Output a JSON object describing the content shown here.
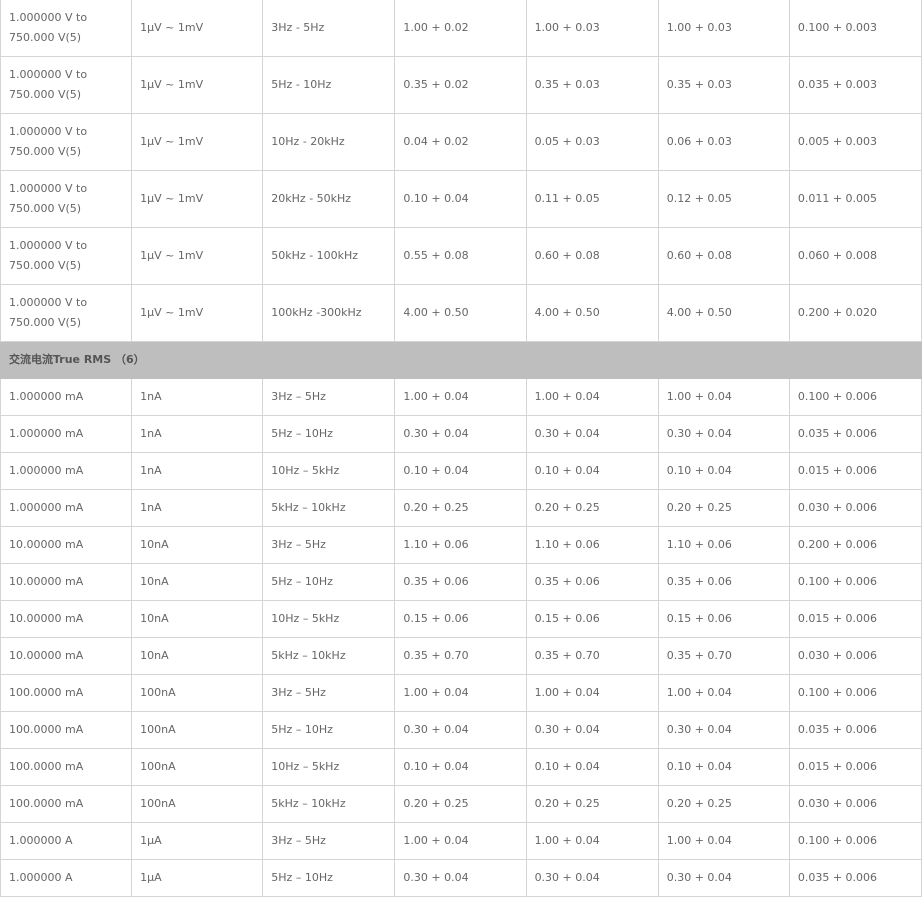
{
  "vac_rows": [
    [
      "1.000000 V to 750.000 V(5)",
      "1μV ~ 1mV",
      "3Hz - 5Hz",
      "1.00 + 0.02",
      "1.00 + 0.03",
      "1.00 + 0.03",
      "0.100 + 0.003"
    ],
    [
      "1.000000 V to 750.000 V(5)",
      "1μV ~ 1mV",
      "5Hz - 10Hz",
      "0.35 + 0.02",
      "0.35 + 0.03",
      "0.35 + 0.03",
      "0.035 + 0.003"
    ],
    [
      "1.000000 V to 750.000 V(5)",
      "1μV ~ 1mV",
      "10Hz - 20kHz",
      "0.04 + 0.02",
      "0.05 + 0.03",
      "0.06 + 0.03",
      "0.005 + 0.003"
    ],
    [
      "1.000000 V to 750.000 V(5)",
      "1μV ~ 1mV",
      "20kHz - 50kHz",
      "0.10 + 0.04",
      "0.11 + 0.05",
      "0.12 + 0.05",
      "0.011 + 0.005"
    ],
    [
      "1.000000 V to 750.000 V(5)",
      "1μV ~ 1mV",
      "50kHz - 100kHz",
      "0.55 + 0.08",
      "0.60 + 0.08",
      "0.60 + 0.08",
      "0.060 + 0.008"
    ],
    [
      "1.000000 V to 750.000 V(5)",
      "1μV ~ 1mV",
      "100kHz -300kHz",
      "4.00 + 0.50",
      "4.00 + 0.50",
      "4.00 + 0.50",
      "0.200 + 0.020"
    ]
  ],
  "section_title": "交流电流True RMS （6）",
  "iac_rows": [
    [
      "1.000000 mA",
      "1nA",
      "3Hz – 5Hz",
      "1.00 + 0.04",
      "1.00 + 0.04",
      "1.00 + 0.04",
      "0.100 + 0.006"
    ],
    [
      "1.000000 mA",
      "1nA",
      "5Hz – 10Hz",
      "0.30 + 0.04",
      "0.30 + 0.04",
      "0.30 + 0.04",
      "0.035 + 0.006"
    ],
    [
      "1.000000 mA",
      "1nA",
      "10Hz – 5kHz",
      "0.10 + 0.04",
      "0.10 + 0.04",
      "0.10 + 0.04",
      "0.015 + 0.006"
    ],
    [
      "1.000000 mA",
      "1nA",
      "5kHz – 10kHz",
      "0.20 + 0.25",
      "0.20 + 0.25",
      "0.20 + 0.25",
      "0.030 + 0.006"
    ],
    [
      "10.00000 mA",
      "10nA",
      "3Hz – 5Hz",
      "1.10 + 0.06",
      "1.10 + 0.06",
      "1.10 + 0.06",
      "0.200 + 0.006"
    ],
    [
      "10.00000 mA",
      "10nA",
      "5Hz – 10Hz",
      "0.35 + 0.06",
      "0.35 + 0.06",
      "0.35 + 0.06",
      "0.100 + 0.006"
    ],
    [
      "10.00000 mA",
      "10nA",
      "10Hz – 5kHz",
      "0.15 + 0.06",
      "0.15 + 0.06",
      "0.15 + 0.06",
      "0.015 + 0.006"
    ],
    [
      "10.00000 mA",
      "10nA",
      "5kHz – 10kHz",
      "0.35 + 0.70",
      "0.35 + 0.70",
      "0.35 + 0.70",
      "0.030 + 0.006"
    ],
    [
      "100.0000 mA",
      "100nA",
      "3Hz – 5Hz",
      "1.00 + 0.04",
      "1.00 + 0.04",
      "1.00 + 0.04",
      "0.100 + 0.006"
    ],
    [
      "100.0000 mA",
      "100nA",
      "5Hz – 10Hz",
      "0.30 + 0.04",
      "0.30 + 0.04",
      "0.30 + 0.04",
      "0.035 + 0.006"
    ],
    [
      "100.0000 mA",
      "100nA",
      "10Hz – 5kHz",
      "0.10 + 0.04",
      "0.10 + 0.04",
      "0.10 + 0.04",
      "0.015 + 0.006"
    ],
    [
      "100.0000 mA",
      "100nA",
      "5kHz – 10kHz",
      "0.20 + 0.25",
      "0.20 + 0.25",
      "0.20 + 0.25",
      "0.030 + 0.006"
    ],
    [
      "1.000000 A",
      "1μA",
      "3Hz – 5Hz",
      "1.00 + 0.04",
      "1.00 + 0.04",
      "1.00 + 0.04",
      "0.100 + 0.006"
    ],
    [
      "1.000000 A",
      "1μA",
      "5Hz – 10Hz",
      "0.30 + 0.04",
      "0.30 + 0.04",
      "0.30 + 0.04",
      "0.035 + 0.006"
    ]
  ]
}
